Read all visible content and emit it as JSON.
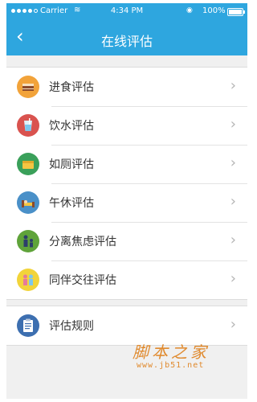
{
  "status": {
    "carrier": "Carrier",
    "time": "4:34 PM",
    "battery": "100%"
  },
  "nav": {
    "title": "在线评估",
    "back": "‹"
  },
  "menu": [
    {
      "label": "进食评估",
      "icon": "food-icon",
      "color": "#f2a33a"
    },
    {
      "label": "饮水评估",
      "icon": "drink-icon",
      "color": "#d9534f"
    },
    {
      "label": "如厕评估",
      "icon": "toilet-icon",
      "color": "#3aa05a"
    },
    {
      "label": "午休评估",
      "icon": "nap-icon",
      "color": "#4a90c8"
    },
    {
      "label": "分离焦虑评估",
      "icon": "separation-anxiety-icon",
      "color": "#5fa33a"
    },
    {
      "label": "同伴交往评估",
      "icon": "peer-interaction-icon",
      "color": "#f2d43a"
    }
  ],
  "rules": {
    "label": "评估规则",
    "icon": "rules-icon",
    "color": "#3d6fb0"
  },
  "chevron": "›",
  "watermark": {
    "site": "脚本之家",
    "url": "www.jb51.net"
  }
}
